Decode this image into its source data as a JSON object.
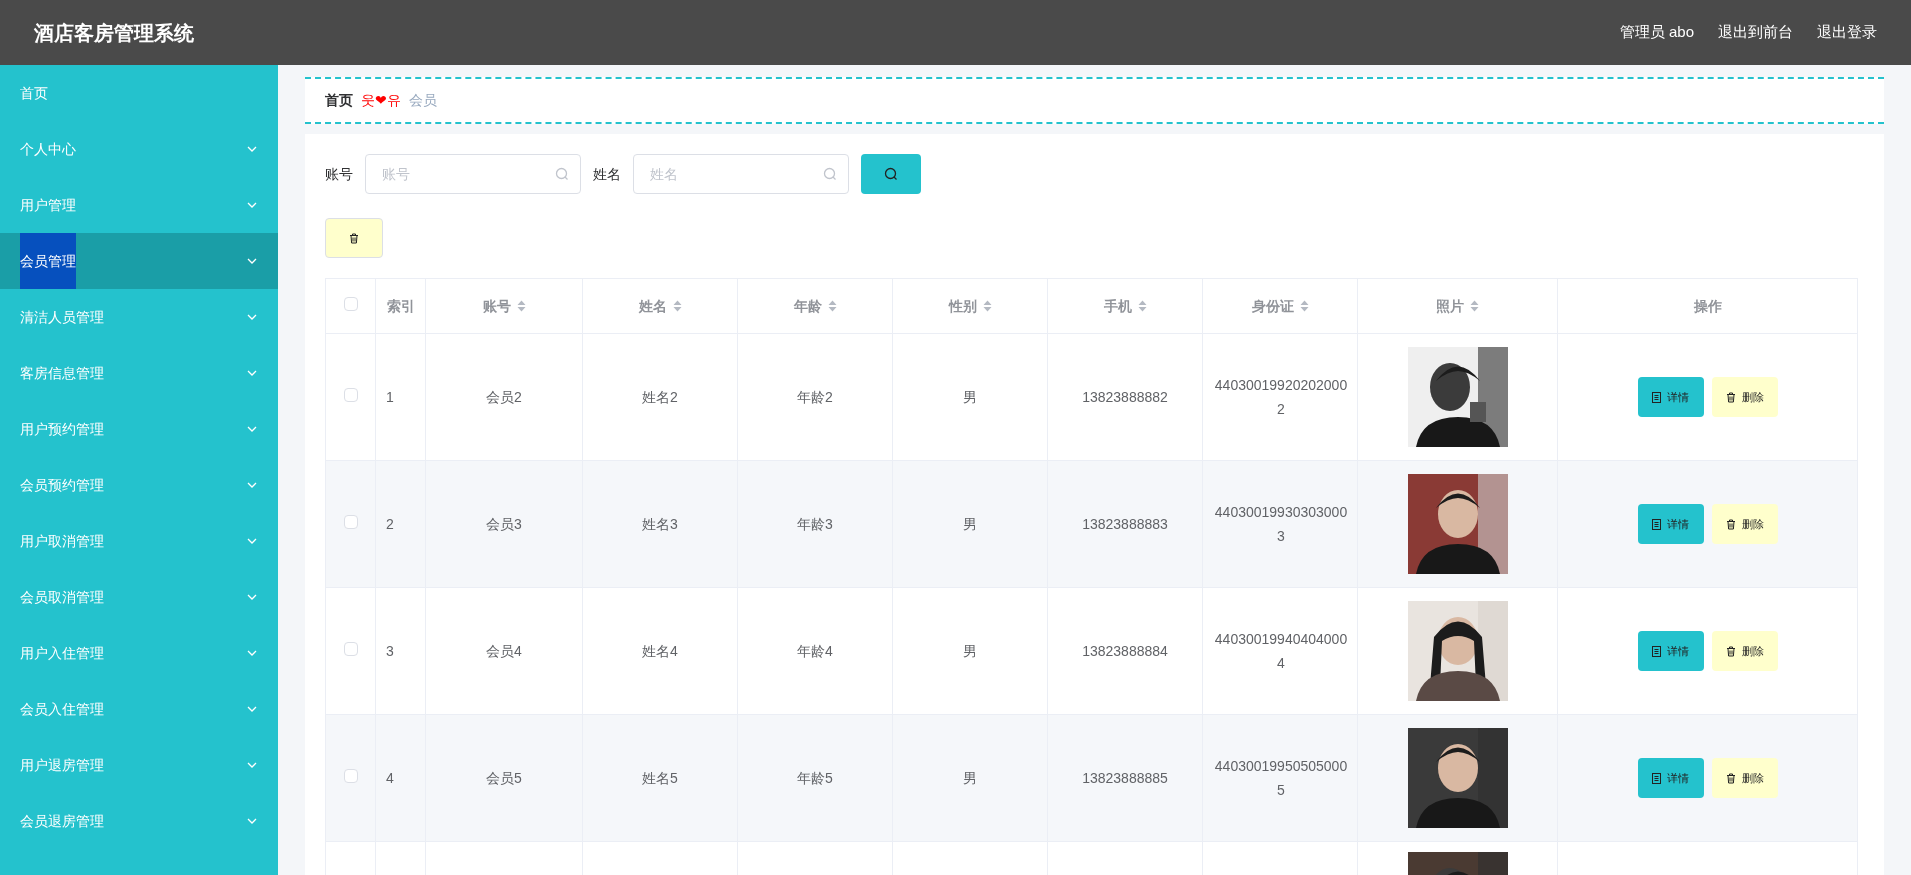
{
  "header": {
    "title": "酒店客房管理系统",
    "links": [
      "管理员 abo",
      "退出到前台",
      "退出登录"
    ]
  },
  "sidebar": {
    "items": [
      {
        "label": "首页",
        "kind": "link",
        "selected": false
      },
      {
        "label": "个人中心",
        "kind": "submenu",
        "selected": false
      },
      {
        "label": "用户管理",
        "kind": "submenu",
        "selected": false
      },
      {
        "label": "会员管理",
        "kind": "submenu",
        "selected": true
      },
      {
        "label": "清洁人员管理",
        "kind": "submenu",
        "selected": false
      },
      {
        "label": "客房信息管理",
        "kind": "submenu",
        "selected": false
      },
      {
        "label": "用户预约管理",
        "kind": "submenu",
        "selected": false
      },
      {
        "label": "会员预约管理",
        "kind": "submenu",
        "selected": false
      },
      {
        "label": "用户取消管理",
        "kind": "submenu",
        "selected": false
      },
      {
        "label": "会员取消管理",
        "kind": "submenu",
        "selected": false
      },
      {
        "label": "用户入住管理",
        "kind": "submenu",
        "selected": false
      },
      {
        "label": "会员入住管理",
        "kind": "submenu",
        "selected": false
      },
      {
        "label": "用户退房管理",
        "kind": "submenu",
        "selected": false
      },
      {
        "label": "会员退房管理",
        "kind": "submenu",
        "selected": false
      }
    ]
  },
  "breadcrumb": {
    "home": "首页",
    "separator": "웃❤유",
    "current": "会员"
  },
  "search": {
    "fields": [
      {
        "label": "账号",
        "placeholder": "账号"
      },
      {
        "label": "姓名",
        "placeholder": "姓名"
      }
    ]
  },
  "table": {
    "select_all": {
      "checked": false
    },
    "columns": [
      {
        "label": "索引",
        "sortable": false
      },
      {
        "label": "账号",
        "sortable": true
      },
      {
        "label": "姓名",
        "sortable": true
      },
      {
        "label": "年龄",
        "sortable": true
      },
      {
        "label": "性别",
        "sortable": true
      },
      {
        "label": "手机",
        "sortable": true
      },
      {
        "label": "身份证",
        "sortable": true
      },
      {
        "label": "照片",
        "sortable": true
      },
      {
        "label": "操作",
        "sortable": false
      }
    ],
    "rows": [
      {
        "checked": false,
        "cells": [
          "1",
          "会员2",
          "姓名2",
          "年龄2",
          "男",
          "13823888882",
          "440300199202020002"
        ],
        "photo": {
          "kind": "picture"
        },
        "actions": [
          "详情",
          "删除"
        ]
      },
      {
        "checked": false,
        "cells": [
          "2",
          "会员3",
          "姓名3",
          "年龄3",
          "男",
          "13823888883",
          "440300199303030003"
        ],
        "photo": {
          "kind": "picture"
        },
        "actions": [
          "详情",
          "删除"
        ]
      },
      {
        "checked": false,
        "cells": [
          "3",
          "会员4",
          "姓名4",
          "年龄4",
          "男",
          "13823888884",
          "440300199404040004"
        ],
        "photo": {
          "kind": "picture"
        },
        "actions": [
          "详情",
          "删除"
        ]
      },
      {
        "checked": false,
        "cells": [
          "4",
          "会员5",
          "姓名5",
          "年龄5",
          "男",
          "13823888885",
          "440300199505050005"
        ],
        "photo": {
          "kind": "picture"
        },
        "actions": [
          "详情",
          "删除"
        ]
      },
      {
        "photo": {
          "kind": "picture"
        }
      }
    ]
  }
}
